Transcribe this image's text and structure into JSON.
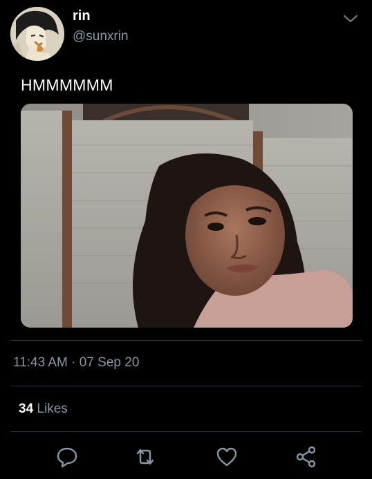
{
  "author": {
    "display_name": "rin",
    "handle": "@sunxrin",
    "avatar_icon": "anime-character-avatar"
  },
  "tweet": {
    "text": "HMMMMMM",
    "media_description_icon": "selfie-photo",
    "timestamp": "11:43 AM · 07 Sep 20"
  },
  "stats": {
    "likes_count": "34",
    "likes_label": "Likes"
  },
  "actions": [
    {
      "icon": "reply-icon"
    },
    {
      "icon": "retweet-icon"
    },
    {
      "icon": "like-icon"
    },
    {
      "icon": "share-icon"
    }
  ],
  "colors": {
    "background": "#000000",
    "primary_text": "#ffffff",
    "secondary_text": "#8899a6",
    "divider": "#2f3336"
  }
}
